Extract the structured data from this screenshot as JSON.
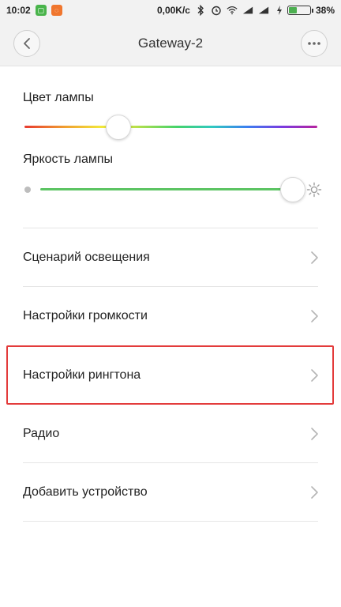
{
  "status_bar": {
    "time": "10:02",
    "net_speed": "0,00K/c",
    "battery_percent": "38%",
    "battery_level": 0.38,
    "icons": [
      "app-green-icon",
      "app-orange-icon",
      "bluetooth-icon",
      "alarm-icon",
      "wifi-icon",
      "signal-icon",
      "signal-icon",
      "charging-icon",
      "battery-icon"
    ]
  },
  "header": {
    "title": "Gateway-2",
    "back_icon": "chevron-left-icon",
    "more_icon": "more-dots-icon"
  },
  "lamp": {
    "color_label": "Цвет лампы",
    "color_position": 0.32,
    "brightness_label": "Яркость лампы",
    "brightness_level": 1.0
  },
  "menu": {
    "items": [
      {
        "label": "Сценарий освещения"
      },
      {
        "label": "Настройки громкости"
      },
      {
        "label": "Настройки рингтона"
      },
      {
        "label": "Радио"
      },
      {
        "label": "Добавить устройство"
      }
    ]
  },
  "colors": {
    "accent_green": "#5cc463",
    "highlight_red": "#e33b3b",
    "header_bg": "#f2f2f2"
  }
}
